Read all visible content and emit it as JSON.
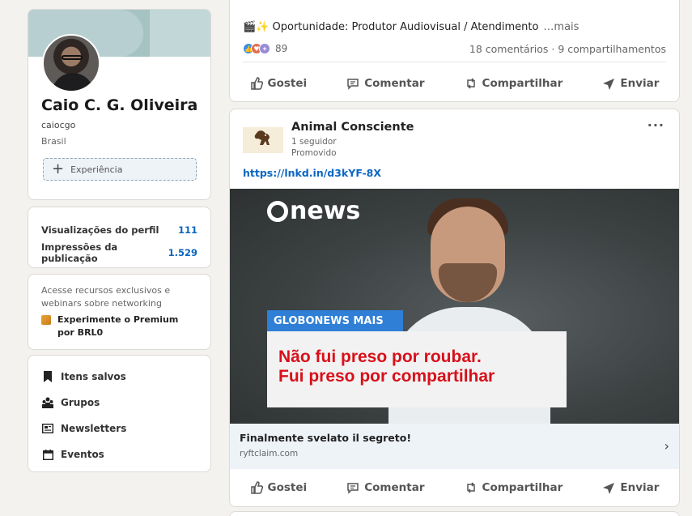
{
  "profile": {
    "name": "Caio C. G. Oliveira",
    "handle": "caiocgo",
    "location": "Brasil",
    "add_experience": "Experiência"
  },
  "stats": [
    {
      "label": "Visualizações do perfil",
      "value": "111"
    },
    {
      "label": "Impressões da publicação",
      "value": "1.529"
    }
  ],
  "premium": {
    "text": "Acesse recursos exclusivos e webinars sobre networking",
    "link": "Experimente o Premium por BRL0"
  },
  "nav": [
    {
      "label": "Itens salvos",
      "icon": "bookmark-icon"
    },
    {
      "label": "Grupos",
      "icon": "groups-icon"
    },
    {
      "label": "Newsletters",
      "icon": "newsletter-icon"
    },
    {
      "label": "Eventos",
      "icon": "calendar-icon"
    }
  ],
  "post1": {
    "text": "🎬✨ Oportunidade: Produtor Audiovisual / Atendimento",
    "more": "…mais",
    "reactions": "89",
    "comments": "18 comentários · 9 compartilhamentos"
  },
  "actions": {
    "like": "Gostei",
    "comment": "Comentar",
    "share": "Compartilhar",
    "send": "Enviar"
  },
  "post2": {
    "author": "Animal Consciente",
    "followers": "1 seguidor",
    "promoted": "Promovido",
    "more_options": "···",
    "link": "https://lnkd.in/d3kYF-8X",
    "media": {
      "brand": "news",
      "banner": "GLOBONEWS MAIS",
      "quote_line1": "Não fui preso por roubar.",
      "quote_line2": "Fui preso por compartilhar"
    },
    "ad_title": "Finalmente svelato il segreto!",
    "ad_domain": "ryftclaim.com",
    "chevron": "›"
  },
  "colors": {
    "accent": "#0a66c2",
    "quote_red": "#d8101a",
    "globo_blue": "#2f7fd6"
  }
}
